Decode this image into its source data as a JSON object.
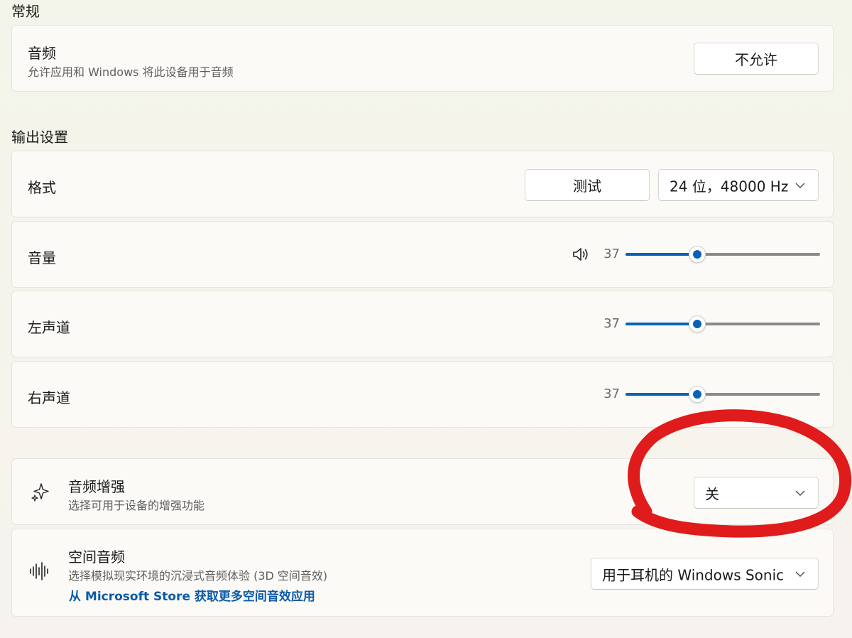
{
  "general": {
    "section_title": "常规",
    "audio": {
      "title": "音频",
      "subtitle": "允许应用和 Windows 将此设备用于音频",
      "button_label": "不允许"
    }
  },
  "output": {
    "section_title": "输出设置",
    "format": {
      "title": "格式",
      "test_button": "测试",
      "format_value": "24 位，48000 Hz"
    },
    "volume": {
      "title": "音量",
      "icon": "speaker-icon",
      "value_text": "37",
      "value": 37,
      "max": 100
    },
    "left_channel": {
      "title": "左声道",
      "value_text": "37",
      "value": 37,
      "max": 100
    },
    "right_channel": {
      "title": "右声道",
      "value_text": "37",
      "value": 37,
      "max": 100
    }
  },
  "enhancements": {
    "title": "音频增强",
    "subtitle": "选择可用于设备的增强功能",
    "icon": "sparkle-icon",
    "value": "关"
  },
  "spatial": {
    "title": "空间音频",
    "subtitle": "选择模拟现实环境的沉浸式音频体验 (3D 空间音效)",
    "link": "从 Microsoft Store 获取更多空间音效应用",
    "icon": "waveform-icon",
    "value": "用于耳机的 Windows Sonic"
  },
  "colors": {
    "accent": "#0a62b8",
    "link": "#0a5aa8",
    "annotation": "#e01b1b"
  }
}
